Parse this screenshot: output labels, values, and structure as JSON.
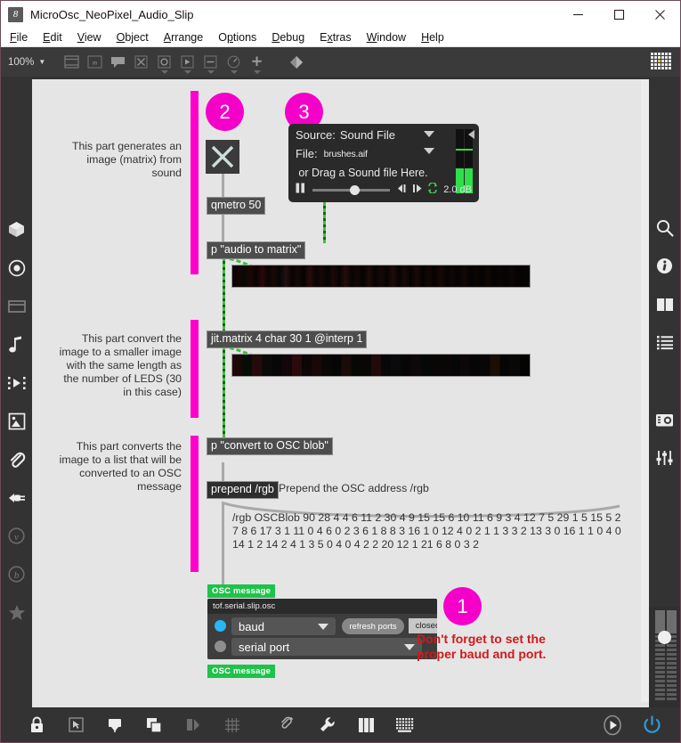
{
  "window": {
    "title": "MicroOsc_NeoPixel_Audio_Slip",
    "app_icon": "8",
    "minimize_label": "minimize-icon",
    "maximize_label": "maximize-icon",
    "close_label": "close-icon"
  },
  "menubar": {
    "items": [
      {
        "label": "File",
        "mnemonic": "F"
      },
      {
        "label": "Edit",
        "mnemonic": "E"
      },
      {
        "label": "View",
        "mnemonic": "V"
      },
      {
        "label": "Object",
        "mnemonic": "O"
      },
      {
        "label": "Arrange",
        "mnemonic": "A"
      },
      {
        "label": "Options",
        "mnemonic": "n"
      },
      {
        "label": "Debug",
        "mnemonic": "D"
      },
      {
        "label": "Extras",
        "mnemonic": "x"
      },
      {
        "label": "Window",
        "mnemonic": "W"
      },
      {
        "label": "Help",
        "mnemonic": "H"
      }
    ]
  },
  "toolbar": {
    "zoom_level": "100%",
    "icons": [
      "panel-icon",
      "message-box-icon",
      "comment-icon",
      "toggle-icon",
      "button-icon",
      "playbar-icon",
      "slider-icon",
      "gauge-icon",
      "add-object-icon",
      "paint-bucket-icon"
    ],
    "grid_icon": "grid-pattern-icon"
  },
  "left_rail": {
    "icons": [
      "cube-3d-icon",
      "target-icon",
      "panel-window-icon",
      "music-note-icon",
      "film-strip-icon",
      "image-icon",
      "paperclip-icon",
      "plug-icon",
      "vizzie-v-icon",
      "beap-b-icon",
      "star-icon"
    ]
  },
  "right_rail": {
    "icons": [
      "search-icon",
      "info-icon",
      "columns-icon",
      "list-icon",
      "snapshot-camera-icon",
      "sliders-icon"
    ]
  },
  "bottom_bar": {
    "icons": [
      "lock-icon",
      "presentation-select-icon",
      "pin-icon",
      "copy-layers-icon",
      "snap-icon",
      "grid-icon",
      "attach-clipping-icon",
      "wrench-icon",
      "keyboard-piano-icon",
      "keyboard-grid-icon"
    ],
    "right_icons": [
      "dsp-power-icon",
      "power-icon"
    ]
  },
  "canvas": {
    "comments": [
      {
        "id": "comment-1",
        "text": "This part generates an image (matrix) from sound"
      },
      {
        "id": "comment-2",
        "text": "This part convert the image to a smaller image with the same length as the number of LEDS (30 in this case)"
      },
      {
        "id": "comment-3",
        "text": "This part converts the image to a list that will be converted to an OSC message"
      }
    ],
    "badges": [
      {
        "number": "1"
      },
      {
        "number": "2"
      },
      {
        "number": "3"
      }
    ],
    "objects": {
      "toggle": "toggle-x-icon",
      "qmetro": "qmetro 50",
      "audio_to_matrix": "p \"audio to matrix\"",
      "jit_matrix": "jit.matrix 4 char 30 1 @interp 1",
      "convert_to_osc": "p \"convert to OSC blob\"",
      "prepend": "prepend /rgb",
      "prepend_comment": "Prepend the OSC address /rgb"
    },
    "sound_panel": {
      "source_label": "Source:",
      "source_value": "Sound File",
      "file_label": "File:",
      "file_value": "brushes.aif",
      "drag_hint": "or Drag a Sound file Here.",
      "gain_value": "2.0 dB",
      "pause_icon": "pause-icon",
      "step_back_icon": "step-back-icon",
      "step_fwd_icon": "step-forward-icon",
      "loop_icon": "loop-icon"
    },
    "osc_blob": {
      "line1": "/rgb OSCBlob 90 28 4 4 6 11 2 30 4 9 15 15 6 10 11 6 9 3 4 12 7 5 29 1 5 15 5 2",
      "line2": "7 8 6 17 3 1 11 0 4 6 0 2 3 6 1 8 8 3 16 1 0 12 4 0 2 1 1 3 3 2 13 3 0 16 1 1 0 4 0",
      "line3": "14 1 2 14 2 4 1 3 5 0 4 0 4 2 2 20 12 1 21 6 8 0 3 2"
    },
    "serial": {
      "tag_top": "OSC message",
      "tag_bottom": "OSC message",
      "title": "tof.serial.slip.osc",
      "baud_label": "baud",
      "serial_port_label": "serial port",
      "refresh_label": "refresh ports",
      "status_label": "closed",
      "baud_led_color": "#29b6f6",
      "port_led_color": "#8e8e8e"
    },
    "warning": {
      "line1": "Don't forget to set the",
      "line2": "proper baud and port.",
      "color": "#d21919"
    }
  },
  "colors": {
    "canvas_bg": "#e5e5e5",
    "chrome_bg": "#333333",
    "accent_magenta": "#f500c8",
    "osc_green": "#1fc24a",
    "cable_gray": "#a9a9a9",
    "cable_green": "#3fbf3f"
  }
}
